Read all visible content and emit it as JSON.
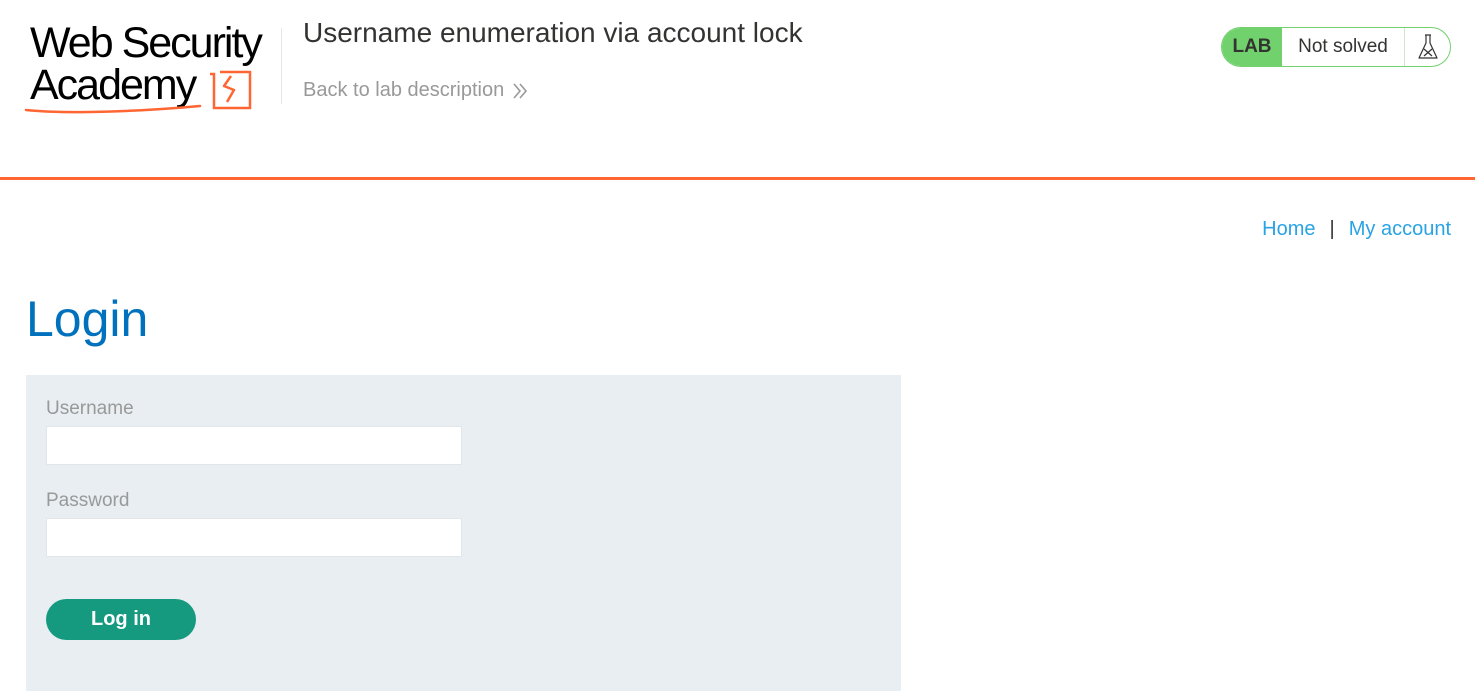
{
  "header": {
    "logo_line1": "Web Security",
    "logo_line2": "Academy",
    "lab_title": "Username enumeration via account lock",
    "back_link": "Back to lab description",
    "lab_badge": "LAB",
    "lab_status": "Not solved"
  },
  "nav": {
    "home": "Home",
    "separator": "|",
    "my_account": "My account"
  },
  "login": {
    "title": "Login",
    "username_label": "Username",
    "username_value": "",
    "password_label": "Password",
    "password_value": "",
    "submit_label": "Log in"
  },
  "colors": {
    "accent_orange": "#ff6633",
    "lab_green": "#70d16d",
    "title_blue": "#0071bc",
    "link_blue": "#29a3e3",
    "button_teal": "#159a7f",
    "panel_bg": "#e8eef1"
  },
  "icons": {
    "back": "double-chevron-right-icon",
    "status": "flask-icon"
  }
}
